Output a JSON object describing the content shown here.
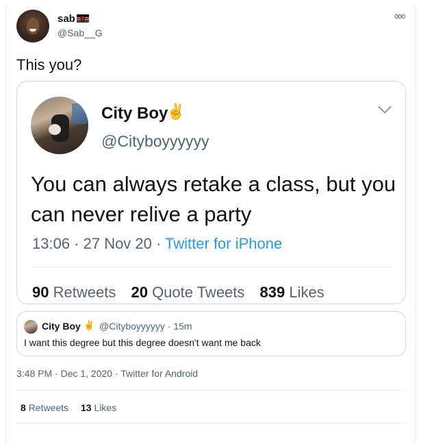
{
  "tweet": {
    "author_name": "sab",
    "author_handle": "@Sab__G",
    "flag_icon": "kenya-flag-icon",
    "more_icon": "ellipsis-icon",
    "text": "This you?",
    "timestamp": "3:48 PM · Dec 1, 2020 · Twitter for Android",
    "stats": {
      "retweets_count": "8",
      "retweets_label": "Retweets",
      "likes_count": "13",
      "likes_label": "Likes"
    }
  },
  "screenshot": {
    "author_name": "City Boy",
    "emoji": "✌",
    "author_handle": "@Cityboyyyyyy",
    "text": "You can always retake a class, but you can never relive a party",
    "time": "13:06 · 27 Nov 20 · ",
    "source": "Twitter for iPhone",
    "retweets_count": "90",
    "retweets_label": "Retweets",
    "quote_count": "20",
    "quote_label": "Quote Tweets",
    "likes_count": "839",
    "likes_label": "Likes"
  },
  "quoted": {
    "author_name": "City Boy",
    "emoji": "✌",
    "author_handle_time": "@Cityboyyyyyy · 15m",
    "text": "I want this degree but this degree doesn't want me back"
  },
  "colors": {
    "text": "#0f1419",
    "secondary": "#536471",
    "link": "#1d9bf0",
    "border": "#cfd9de"
  }
}
